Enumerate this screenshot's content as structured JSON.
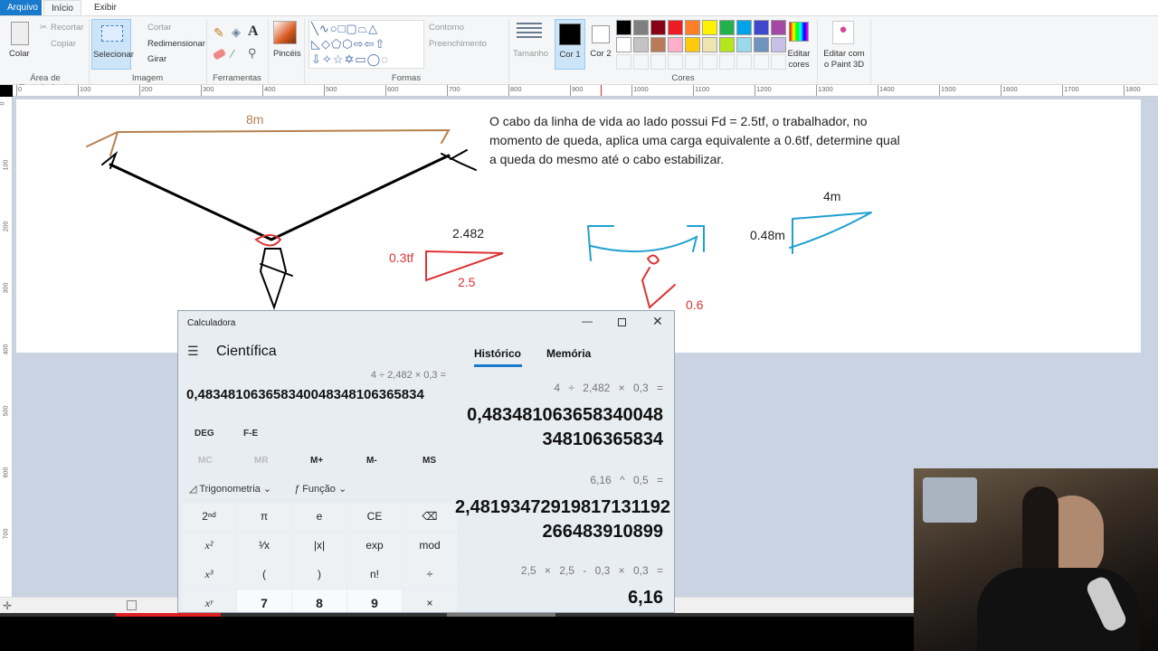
{
  "ribbon": {
    "tabs": [
      "Arquivo",
      "Início",
      "Exibir"
    ],
    "clipboard": {
      "paste": "Colar",
      "cut": "Recortar",
      "copy": "Copiar",
      "group": "Área de Transferência"
    },
    "image": {
      "select": "Selecionar",
      "crop": "Cortar",
      "resize": "Redimensionar",
      "rotate": "Girar",
      "group": "Imagem"
    },
    "tools": {
      "group": "Ferramentas"
    },
    "brushes": "Pincéis",
    "shapes": {
      "outline": "Contorno",
      "fill": "Preenchimento",
      "group": "Formas"
    },
    "size": "Tamanho",
    "color1": "Cor 1",
    "color2": "Cor 2",
    "edit_colors": "Editar cores",
    "paint3d": "Editar com o Paint 3D",
    "colors_group": "Cores",
    "palette": [
      "#000000",
      "#7f7f7f",
      "#880015",
      "#ed1c24",
      "#ff7f27",
      "#fff200",
      "#22b14c",
      "#00a2e8",
      "#3f48cc",
      "#a349a4",
      "#ffffff",
      "#c3c3c3",
      "#b97a57",
      "#ffaec9",
      "#ffc90e",
      "#efe4b0",
      "#b5e61d",
      "#99d9ea",
      "#7092be",
      "#c8bfe7"
    ]
  },
  "ruler": {
    "h": [
      "0",
      "100",
      "200",
      "300",
      "400",
      "500",
      "600",
      "700",
      "800",
      "900",
      "1000",
      "1100",
      "1200",
      "1300",
      "1400",
      "1500",
      "1600",
      "1700",
      "1800"
    ],
    "v": [
      "0",
      "100",
      "200",
      "300",
      "400",
      "500",
      "600",
      "700"
    ]
  },
  "canvas": {
    "span_label": "8m",
    "problem": "O cabo da linha de vida ao lado possui Fd = 2.5tf, o trabalhador, no momento de queda, aplica uma carga equivalente a 0.6tf, determine qual a queda do mesmo até o cabo estabilizar.",
    "tri_top": "2.482",
    "tri_left": "0.3tf",
    "tri_bottom": "2.5",
    "load": "0.6",
    "tri2_top": "4m",
    "tri2_left": "0.48m"
  },
  "calculator": {
    "title": "Calculadora",
    "mode": "Científica",
    "tabs": [
      "Histórico",
      "Memória"
    ],
    "expression": "4 ÷ 2,482 × 0,3 =",
    "display": "0,4834810636583400483481063658 34",
    "display_value": "0,48348106365834004834810636583 4",
    "angle": "DEG",
    "fe": "F-E",
    "memory": [
      "MC",
      "MR",
      "M+",
      "M-",
      "MS"
    ],
    "trig": "Trigonometria",
    "func": "Função",
    "keys": [
      "2ⁿᵈ",
      "π",
      "e",
      "CE",
      "⌫",
      "x²",
      "¹⁄x",
      "|x|",
      "exp",
      "mod",
      "x³",
      "(",
      ")",
      "n!",
      "÷",
      "xʸ",
      "7",
      "8",
      "9",
      "×"
    ],
    "history": [
      {
        "expr": "4 ÷ 2,482 × 0,3 =",
        "result": "0,483481063658340048 348106365834"
      },
      {
        "expr": "6,16 ^ 0,5 =",
        "result": "2,48193472919817131192 266483910899"
      },
      {
        "expr": "2,5 × 2,5 - 0,3 × 0,3 =",
        "result": "6,16"
      }
    ]
  }
}
